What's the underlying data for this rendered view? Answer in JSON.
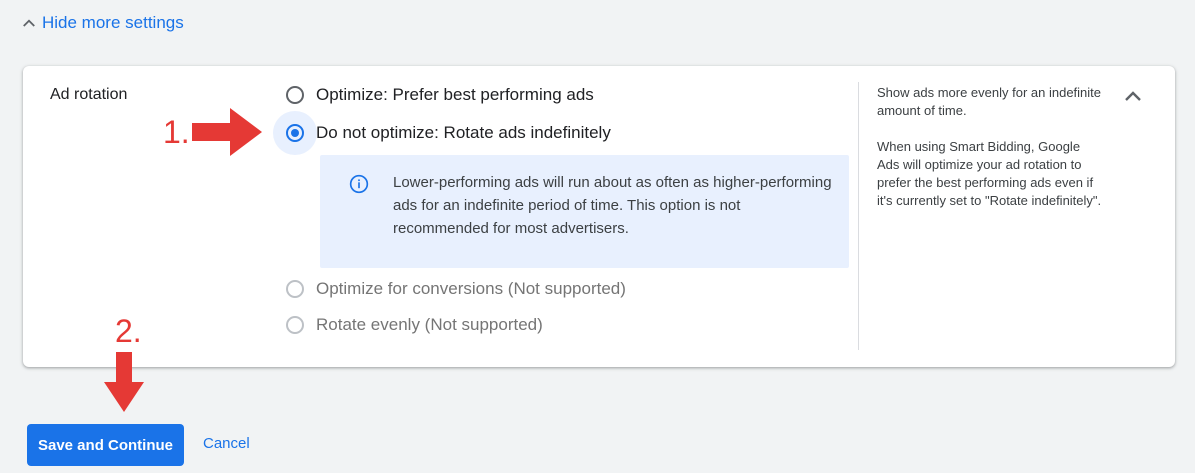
{
  "toggle": {
    "label": "Hide more settings",
    "icon": "chevron-up-icon"
  },
  "section": {
    "label": "Ad rotation"
  },
  "options": [
    {
      "label": "Optimize: Prefer best performing ads",
      "selected": false,
      "disabled": false
    },
    {
      "label": "Do not optimize: Rotate ads indefinitely",
      "selected": true,
      "disabled": false
    },
    {
      "label": "Optimize for conversions (Not supported)",
      "selected": false,
      "disabled": true
    },
    {
      "label": "Rotate evenly (Not supported)",
      "selected": false,
      "disabled": true
    }
  ],
  "info": {
    "icon": "info-icon",
    "text": "Lower-performing ads will run about as often as higher-performing ads for an indefinite period of time. This option is not recommended for most advertisers."
  },
  "help": {
    "p1": "Show ads more evenly for an indefinite amount of time.",
    "p2": "When using Smart Bidding, Google Ads will optimize your ad rotation to prefer the best performing ads even if it's currently set to \"Rotate indefinitely\"."
  },
  "annotations": {
    "step1": "1.",
    "step2": "2.",
    "color": "#e53935"
  },
  "actions": {
    "save_label": "Save and Continue",
    "cancel_label": "Cancel"
  },
  "colors": {
    "accent": "#1a73e8",
    "info_bg": "#e8f0fe",
    "page_bg": "#f1f3f4"
  }
}
